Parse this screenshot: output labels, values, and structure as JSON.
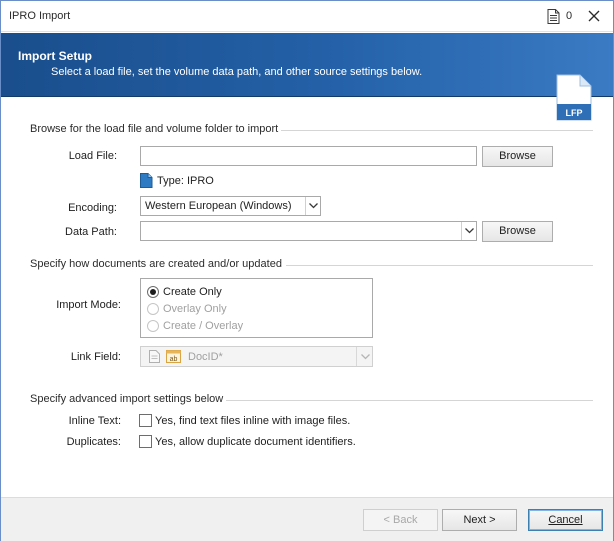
{
  "window": {
    "title": "IPRO Import",
    "notes_count": "0"
  },
  "header": {
    "title": "Import Setup",
    "subtitle": "Select a load file, set the volume data path, and other source settings below.",
    "icon_label": "LFP"
  },
  "source": {
    "section_title": "Browse for the load file and volume folder to import",
    "load_file_label": "Load File:",
    "load_file_value": "",
    "browse_label": "Browse",
    "type_text": "Type: IPRO",
    "encoding_label": "Encoding:",
    "encoding_value": "Western European (Windows)",
    "data_path_label": "Data Path:",
    "data_path_value": ""
  },
  "documents": {
    "section_title": "Specify how documents are created and/or updated",
    "import_mode_label": "Import Mode:",
    "modes": [
      {
        "label": "Create Only",
        "checked": true,
        "enabled": true
      },
      {
        "label": "Overlay Only",
        "checked": false,
        "enabled": false
      },
      {
        "label": "Create / Overlay",
        "checked": false,
        "enabled": false
      }
    ],
    "link_field_label": "Link Field:",
    "link_field_value": "DocID*"
  },
  "advanced": {
    "section_title": "Specify advanced import settings below",
    "inline_text_label": "Inline Text:",
    "inline_text_option": "Yes, find text files inline with image files.",
    "duplicates_label": "Duplicates:",
    "duplicates_option": "Yes, allow duplicate document identifiers."
  },
  "footer": {
    "back_label": "< Back",
    "next_label": "Next >",
    "cancel_label": "Cancel"
  },
  "colors": {
    "banner": "#2461a8",
    "default_button_border": "#3c7fb1"
  }
}
